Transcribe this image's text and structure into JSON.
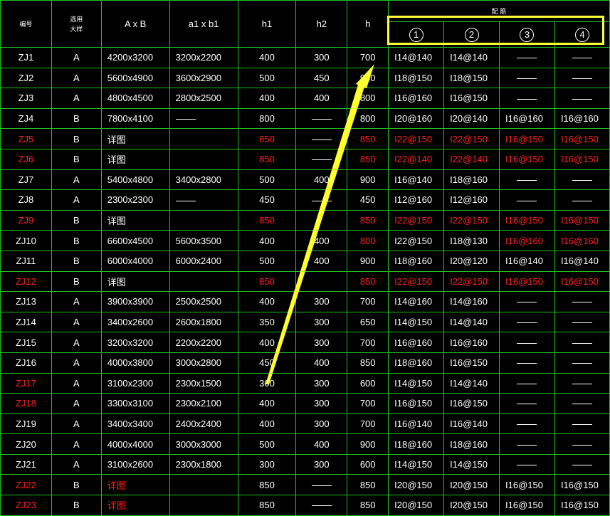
{
  "header": {
    "id": "编号",
    "style_line1": "选用",
    "style_line2": "大样",
    "ab": "A x B",
    "a1b1": "a1 x b1",
    "h1": "h1",
    "h2": "h2",
    "h": "h",
    "rebar": "配 筋",
    "col1": "1",
    "col2": "2",
    "col3": "3",
    "col4": "4"
  },
  "rows": [
    {
      "id": "ZJ1",
      "style": "A",
      "ab": "4200x3200",
      "a1b1": "3200x2200",
      "h1": "400",
      "h2": "300",
      "h": "700",
      "r1": "I14@140",
      "r2": "I14@140",
      "r3": "—",
      "r4": "—",
      "red": false,
      "redcols": []
    },
    {
      "id": "ZJ2",
      "style": "A",
      "ab": "5600x4900",
      "a1b1": "3600x2900",
      "h1": "500",
      "h2": "450",
      "h": "950",
      "r1": "I18@150",
      "r2": "I18@150",
      "r3": "—",
      "r4": "—",
      "red": false,
      "redcols": []
    },
    {
      "id": "ZJ3",
      "style": "A",
      "ab": "4800x4500",
      "a1b1": "2800x2500",
      "h1": "400",
      "h2": "400",
      "h": "800",
      "r1": "I16@160",
      "r2": "I16@150",
      "r3": "—",
      "r4": "—",
      "red": false,
      "redcols": []
    },
    {
      "id": "ZJ4",
      "style": "B",
      "ab": "7800x4100",
      "a1b1": "—",
      "h1": "800",
      "h2": "—",
      "h": "800",
      "r1": "I20@160",
      "r2": "I20@140",
      "r3": "I16@160",
      "r4": "I16@160",
      "red": false,
      "redcols": []
    },
    {
      "id": "ZJ5",
      "style": "B",
      "ab": "详图",
      "a1b1": "",
      "h1": "850",
      "h2": "—",
      "h": "850",
      "r1": "I22@150",
      "r2": "I22@150",
      "r3": "I16@150",
      "r4": "I16@150",
      "red": true,
      "redcols": [
        "id",
        "h1",
        "h",
        "r1",
        "r2",
        "r3",
        "r4"
      ]
    },
    {
      "id": "ZJ6",
      "style": "B",
      "ab": "详图",
      "a1b1": "",
      "h1": "850",
      "h2": "—",
      "h": "850",
      "r1": "I22@140",
      "r2": "I22@140",
      "r3": "I16@150",
      "r4": "I16@150",
      "red": true,
      "redcols": [
        "id",
        "h1",
        "h",
        "r1",
        "r2",
        "r3",
        "r4"
      ]
    },
    {
      "id": "ZJ7",
      "style": "A",
      "ab": "5400x4800",
      "a1b1": "3400x2800",
      "h1": "500",
      "h2": "400",
      "h": "900",
      "r1": "I16@140",
      "r2": "I18@160",
      "r3": "—",
      "r4": "—",
      "red": false,
      "redcols": []
    },
    {
      "id": "ZJ8",
      "style": "A",
      "ab": "2300x2300",
      "a1b1": "—",
      "h1": "450",
      "h2": "—",
      "h": "450",
      "r1": "I12@160",
      "r2": "I12@160",
      "r3": "—",
      "r4": "—",
      "red": false,
      "redcols": []
    },
    {
      "id": "ZJ9",
      "style": "B",
      "ab": "详图",
      "a1b1": "",
      "h1": "850",
      "h2": "",
      "h": "850",
      "r1": "I22@150",
      "r2": "I22@150",
      "r3": "I16@150",
      "r4": "I16@150",
      "red": true,
      "redcols": [
        "id",
        "h1",
        "h",
        "r1",
        "r2",
        "r3",
        "r4"
      ]
    },
    {
      "id": "ZJ10",
      "style": "B",
      "ab": "6600x4500",
      "a1b1": "5600x3500",
      "h1": "400",
      "h2": "400",
      "h": "800",
      "r1": "I22@150",
      "r2": "I18@130",
      "r3": "I16@160",
      "r4": "I16@160",
      "red": false,
      "redcols": [
        "h",
        "r3",
        "r4"
      ]
    },
    {
      "id": "ZJ11",
      "style": "B",
      "ab": "6000x4000",
      "a1b1": "6000x2400",
      "h1": "500",
      "h2": "400",
      "h": "900",
      "r1": "I18@160",
      "r2": "I20@120",
      "r3": "I16@140",
      "r4": "I16@140",
      "red": false,
      "redcols": []
    },
    {
      "id": "ZJ12",
      "style": "B",
      "ab": "详图",
      "a1b1": "",
      "h1": "850",
      "h2": "",
      "h": "850",
      "r1": "I22@150",
      "r2": "I22@150",
      "r3": "I16@150",
      "r4": "I16@150",
      "red": true,
      "redcols": [
        "id",
        "h1",
        "h",
        "r1",
        "r2",
        "r3",
        "r4"
      ]
    },
    {
      "id": "ZJ13",
      "style": "A",
      "ab": "3900x3900",
      "a1b1": "2500x2500",
      "h1": "400",
      "h2": "300",
      "h": "700",
      "r1": "I14@160",
      "r2": "I14@160",
      "r3": "—",
      "r4": "—",
      "red": false,
      "redcols": []
    },
    {
      "id": "ZJ14",
      "style": "A",
      "ab": "3400x2600",
      "a1b1": "2600x1800",
      "h1": "350",
      "h2": "300",
      "h": "650",
      "r1": "I14@150",
      "r2": "I14@140",
      "r3": "—",
      "r4": "—",
      "red": false,
      "redcols": []
    },
    {
      "id": "ZJ15",
      "style": "A",
      "ab": "3200x3200",
      "a1b1": "2200x2200",
      "h1": "400",
      "h2": "300",
      "h": "700",
      "r1": "I16@160",
      "r2": "I16@160",
      "r3": "—",
      "r4": "—",
      "red": false,
      "redcols": []
    },
    {
      "id": "ZJ16",
      "style": "A",
      "ab": "4000x3800",
      "a1b1": "3000x2800",
      "h1": "450",
      "h2": "400",
      "h": "850",
      "r1": "I18@160",
      "r2": "I16@150",
      "r3": "—",
      "r4": "—",
      "red": false,
      "redcols": []
    },
    {
      "id": "ZJ17",
      "style": "A",
      "ab": "3100x2300",
      "a1b1": "2300x1500",
      "h1": "300",
      "h2": "300",
      "h": "600",
      "r1": "I14@150",
      "r2": "I14@140",
      "r3": "—",
      "r4": "—",
      "red": false,
      "redcols": [
        "id"
      ]
    },
    {
      "id": "ZJ18",
      "style": "A",
      "ab": "3300x3100",
      "a1b1": "2300x2100",
      "h1": "400",
      "h2": "300",
      "h": "700",
      "r1": "I16@150",
      "r2": "I16@150",
      "r3": "—",
      "r4": "—",
      "red": false,
      "redcols": [
        "id"
      ]
    },
    {
      "id": "ZJ19",
      "style": "A",
      "ab": "3400x3400",
      "a1b1": "2400x2400",
      "h1": "400",
      "h2": "300",
      "h": "700",
      "r1": "I16@140",
      "r2": "I16@140",
      "r3": "—",
      "r4": "—",
      "red": false,
      "redcols": []
    },
    {
      "id": "ZJ20",
      "style": "A",
      "ab": "4000x4000",
      "a1b1": "3000x3000",
      "h1": "500",
      "h2": "400",
      "h": "900",
      "r1": "I18@160",
      "r2": "I18@160",
      "r3": "—",
      "r4": "—",
      "red": false,
      "redcols": []
    },
    {
      "id": "ZJ21",
      "style": "A",
      "ab": "3100x2600",
      "a1b1": "2300x1800",
      "h1": "300",
      "h2": "300",
      "h": "600",
      "r1": "I14@150",
      "r2": "I14@150",
      "r3": "—",
      "r4": "—",
      "red": false,
      "redcols": []
    },
    {
      "id": "ZJ22",
      "style": "B",
      "ab": "详图",
      "a1b1": "",
      "h1": "850",
      "h2": "—",
      "h": "850",
      "r1": "I20@150",
      "r2": "I20@150",
      "r3": "I16@150",
      "r4": "I16@150",
      "red": false,
      "redcols": [
        "id",
        "ab"
      ]
    },
    {
      "id": "ZJ23",
      "style": "B",
      "ab": "详图",
      "a1b1": "",
      "h1": "850",
      "h2": "—",
      "h": "850",
      "r1": "I20@150",
      "r2": "I20@150",
      "r3": "I16@150",
      "r4": "I16@150",
      "red": false,
      "redcols": [
        "id",
        "ab"
      ]
    }
  ],
  "colors": {
    "grid": "#20c020",
    "red": "#ff2020",
    "highlight": "#ffff30",
    "arrow": "#ffff30",
    "background": "#000000"
  }
}
